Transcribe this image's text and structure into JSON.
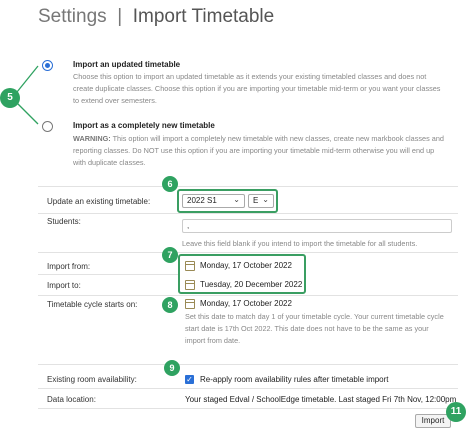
{
  "header": {
    "breadcrumb_root": "Settings",
    "page_title": "Import Timetable"
  },
  "options": [
    {
      "title": "Import an updated timetable",
      "description": "Choose this option to import an updated timetable as it extends your existing timetabled classes and does not create duplicate classes. Choose this option if you are importing your timetable mid-term or you want your classes to extend over semesters.",
      "selected": true
    },
    {
      "title": "Import as a completely new timetable",
      "warning_label": "WARNING:",
      "description": " This option will import a completely new timetable with new classes, create new markbook classes and reporting classes. Do NOT use this option if you are importing your timetable mid-term otherwise you will end up with duplicate classes.",
      "selected": false
    }
  ],
  "form": {
    "existing_timetable": {
      "label": "Update an existing timetable:",
      "timetable_value": "2022 S1",
      "segment_value": "E"
    },
    "students": {
      "label": "Students:",
      "value": ",",
      "help": "Leave this field blank if you intend to import the timetable for all students."
    },
    "import_from": {
      "label": "Import from:",
      "value": "Monday, 17 October 2022"
    },
    "import_to": {
      "label": "Import to:",
      "value": "Tuesday, 20 December 2022"
    },
    "cycle_start": {
      "label": "Timetable cycle starts on:",
      "value": "Monday, 17 October 2022",
      "help": "Set this date to match day 1 of your timetable cycle. Your current timetable cycle start date is 17th Oct 2022. This date does not have to be the same as your import from date."
    },
    "room_availability": {
      "label": "Existing room availability:",
      "checkbox_label": "Re-apply room availability rules after timetable import",
      "checked": true
    },
    "data_location": {
      "label": "Data location:",
      "value": "Your staged Edval / SchoolEdge timetable. Last staged Fri 7th Nov, 12:00pm"
    }
  },
  "actions": {
    "import_label": "Import"
  },
  "annotations": {
    "b5": "5",
    "b6": "6",
    "b7": "7",
    "b8": "8",
    "b9": "9",
    "b11": "11"
  },
  "colors": {
    "accent": "#2fa261",
    "radio": "#2a6fd6"
  }
}
